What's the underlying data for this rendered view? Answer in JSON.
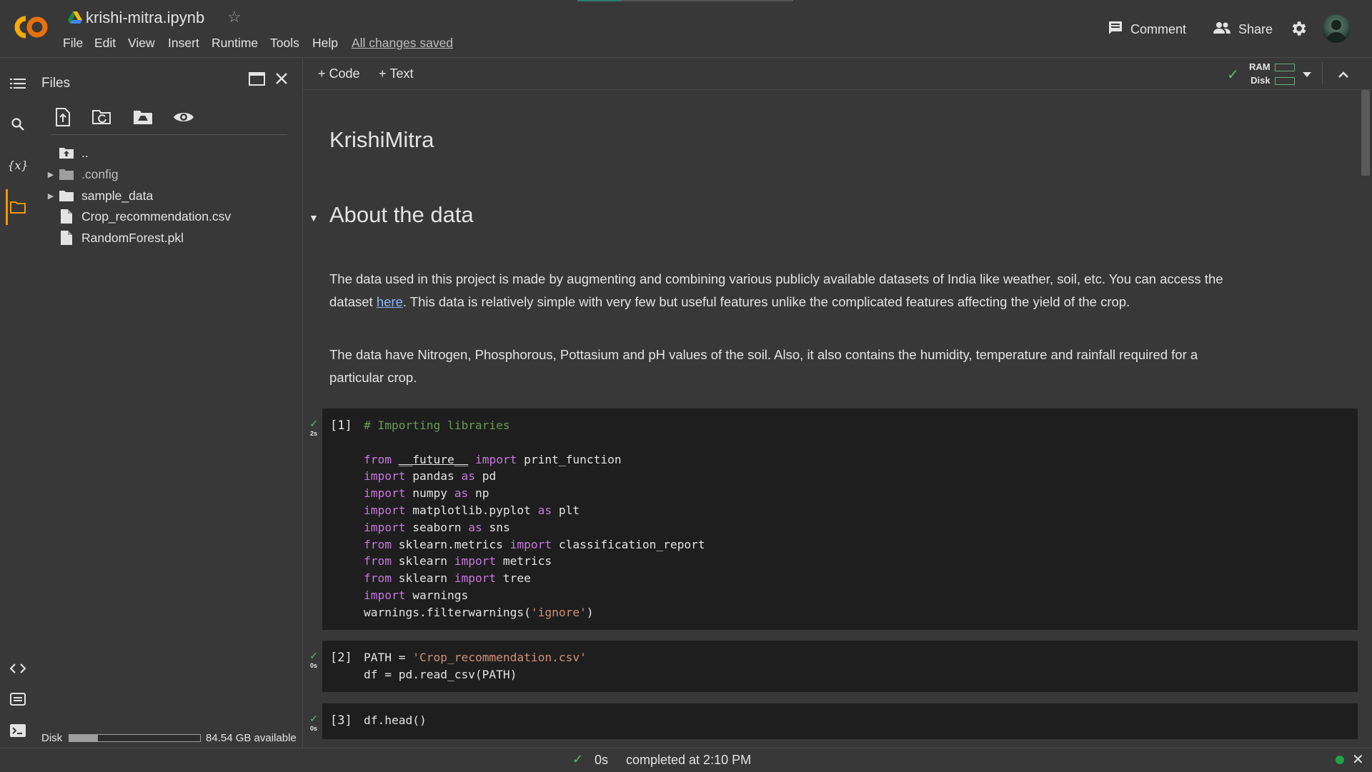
{
  "header": {
    "title": "krishi-mitra.ipynb",
    "menu": [
      "File",
      "Edit",
      "View",
      "Insert",
      "Runtime",
      "Tools",
      "Help"
    ],
    "save_status": "All changes saved",
    "comment_label": "Comment",
    "share_label": "Share",
    "logo_text": "CO"
  },
  "files_panel": {
    "title": "Files",
    "items": [
      {
        "name": "..",
        "type": "parent-folder"
      },
      {
        "name": ".config",
        "type": "folder"
      },
      {
        "name": "sample_data",
        "type": "folder"
      },
      {
        "name": "Crop_recommendation.csv",
        "type": "file"
      },
      {
        "name": "RandomForest.pkl",
        "type": "file"
      }
    ],
    "disk_label": "Disk",
    "disk_available": "84.54 GB available",
    "disk_used_fraction": 0.22
  },
  "toolbar": {
    "add_code": "Code",
    "add_text": "Text",
    "ram_label": "RAM",
    "disk_label": "Disk"
  },
  "notebook": {
    "title": "KrishiMitra",
    "section_title": "About the data",
    "paragraph1_before": "The data used in this project is made by augmenting and combining various publicly available datasets of India like weather, soil, etc. You can access the dataset ",
    "paragraph1_link": "here",
    "paragraph1_after": ". This data is relatively simple with very few but useful features unlike the complicated features affecting the yield of the crop.",
    "paragraph2": "The data have Nitrogen, Phosphorous, Pottasium and pH values of the soil. Also, it also contains the humidity, temperature and rainfall required for a particular crop.",
    "cells": [
      {
        "exec": "[1]",
        "time": "2s"
      },
      {
        "exec": "[2]",
        "time": "0s"
      },
      {
        "exec": "[3]",
        "time": "0s"
      }
    ]
  },
  "status_bar": {
    "time": "0s",
    "message": "completed at 2:10 PM"
  },
  "colors": {
    "background": "#383838",
    "code_background": "#1e1e1e",
    "accent": "#f29900",
    "link": "#8ab4f8",
    "success": "#5bb974",
    "keyword": "#c678dd",
    "string": "#ce9178",
    "comment": "#6a9955"
  }
}
